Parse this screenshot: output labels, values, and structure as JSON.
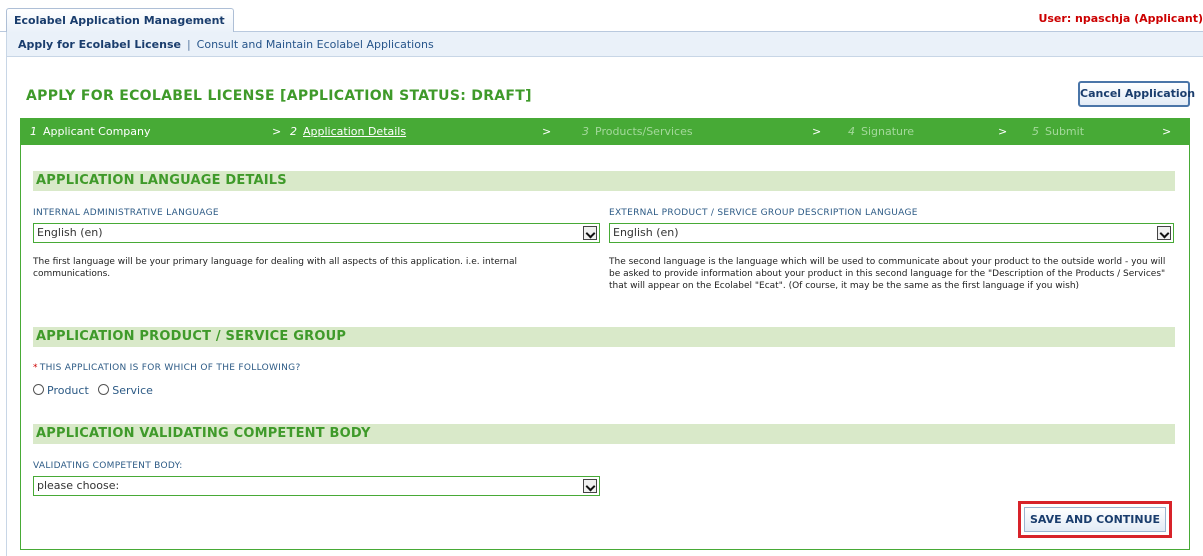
{
  "header": {
    "main_tab": "Ecolabel Application Management",
    "user_info": "User: npaschja (Applicant)"
  },
  "subnav": {
    "active": "Apply for Ecolabel License",
    "separator": "|",
    "link": "Consult and Maintain Ecolabel Applications"
  },
  "page": {
    "title": "APPLY FOR ECOLABEL LICENSE [APPLICATION STATUS: DRAFT]",
    "cancel_label": "Cancel Application"
  },
  "steps": [
    {
      "num": "1",
      "label": "Applicant Company",
      "state": "done"
    },
    {
      "num": "2",
      "label": "Application Details",
      "state": "current"
    },
    {
      "num": "3",
      "label": "Products/Services",
      "state": "future"
    },
    {
      "num": "4",
      "label": "Signature",
      "state": "future"
    },
    {
      "num": "5",
      "label": "Submit",
      "state": "future"
    }
  ],
  "step_separator": ">",
  "language_section": {
    "title": "APPLICATION LANGUAGE DETAILS",
    "internal_label": "INTERNAL ADMINISTRATIVE LANGUAGE",
    "internal_value": "English (en)",
    "internal_help": "The first language will be your primary language for dealing with all aspects of this application. i.e. internal communications.",
    "external_label": "EXTERNAL PRODUCT / SERVICE GROUP DESCRIPTION LANGUAGE",
    "external_value": "English (en)",
    "external_help": "The second language is the language which will be used to communicate about your product to the outside world - you will be asked to provide information about your product in this second language for the \"Description of the Products / Services\" that will appear on the Ecolabel \"Ecat\". (Of course, it may be the same as the first language if you wish)"
  },
  "group_section": {
    "title": "APPLICATION PRODUCT / SERVICE GROUP",
    "required_mark": "*",
    "question": "THIS APPLICATION IS FOR WHICH OF THE FOLLOWING?",
    "option_product": "Product",
    "option_service": "Service"
  },
  "body_section": {
    "title": "APPLICATION VALIDATING COMPETENT BODY",
    "label": "VALIDATING COMPETENT BODY:",
    "value": "please choose:"
  },
  "actions": {
    "save_label": "SAVE AND CONTINUE"
  },
  "colors": {
    "brand_green": "#47aa36",
    "section_bg": "#d9e9c9",
    "user_red": "#cc0000",
    "highlight_red": "#d8232a"
  }
}
